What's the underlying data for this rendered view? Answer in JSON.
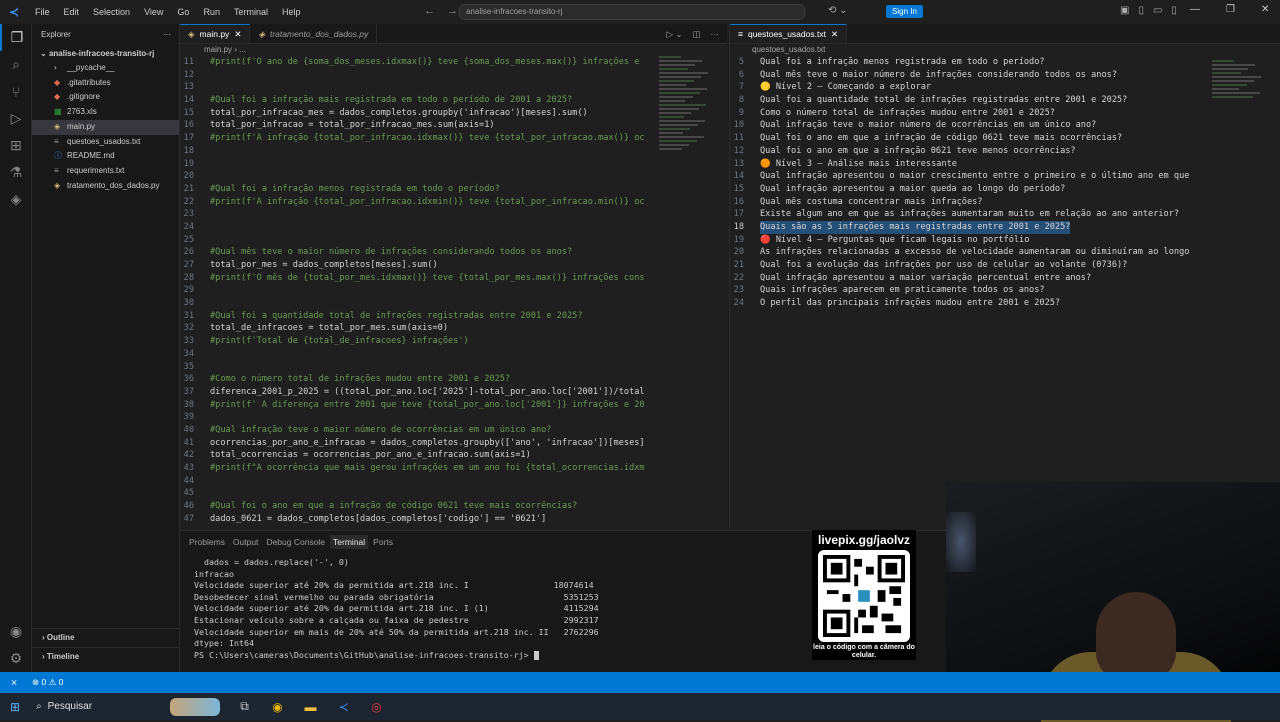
{
  "titlebar": {
    "menu": [
      "File",
      "Edit",
      "Selection",
      "View",
      "Go",
      "Run",
      "Terminal",
      "Help"
    ],
    "search": "analise-infracoes-transito-rj",
    "signin": "Sign In"
  },
  "explorer": {
    "header": "Explorer",
    "project": "analise-infracoes-transito-rj",
    "files": [
      {
        "name": "__pycache__",
        "icon": "chevron-right-icon",
        "glyph": "›"
      },
      {
        "name": ".gitattributes",
        "icon": "git-icon",
        "glyph": "◆"
      },
      {
        "name": ".gitignore",
        "icon": "git-icon",
        "glyph": "◆"
      },
      {
        "name": "2763.xls",
        "icon": "excel-icon",
        "glyph": "▦"
      },
      {
        "name": "main.py",
        "icon": "python-icon",
        "glyph": "◈"
      },
      {
        "name": "questoes_usados.txt",
        "icon": "text-file-icon",
        "glyph": "≡"
      },
      {
        "name": "README.md",
        "icon": "info-icon",
        "glyph": "ⓘ"
      },
      {
        "name": "requeriments.txt",
        "icon": "text-file-icon",
        "glyph": "≡"
      },
      {
        "name": "tratamento_dos_dados.py",
        "icon": "python-icon",
        "glyph": "◈"
      }
    ],
    "outline": "Outline",
    "timeline": "Timeline"
  },
  "editor_left": {
    "tabs": [
      "main.py",
      "tratamento_dos_dados.py"
    ],
    "breadcrumb": "main.py › ...",
    "lines": [
      {
        "n": "11",
        "t": "#print(f'O ano de {soma_dos_meses.idxmax()} teve {soma_dos_meses.max()} infrações e",
        "c": true
      },
      {
        "n": "12",
        "t": "",
        "c": false
      },
      {
        "n": "13",
        "t": "",
        "c": false
      },
      {
        "n": "14",
        "t": "#Qual foi a infração mais registrada em todo o período de 2001 a 2025?",
        "c": true
      },
      {
        "n": "15",
        "t": "total_por_infracao_mes = dados_completos.groupby('infracao')[meses].sum()",
        "c": false
      },
      {
        "n": "16",
        "t": "total_por_infracao = total_por_infracao_mes.sum(axis=1)",
        "c": false
      },
      {
        "n": "17",
        "t": "#print(f'A infração {total_por_infracao.idxmax()} teve {total_por_infracao.max()} oc",
        "c": true
      },
      {
        "n": "18",
        "t": "",
        "c": false
      },
      {
        "n": "19",
        "t": "",
        "c": false
      },
      {
        "n": "20",
        "t": "",
        "c": false
      },
      {
        "n": "21",
        "t": "#Qual foi a infração menos registrada em todo o período?",
        "c": true
      },
      {
        "n": "22",
        "t": "#print(f'A infração {total_por_infracao.idxmin()} teve {total_por_infracao.min()} oc",
        "c": true
      },
      {
        "n": "23",
        "t": "",
        "c": false
      },
      {
        "n": "24",
        "t": "",
        "c": false
      },
      {
        "n": "25",
        "t": "",
        "c": false
      },
      {
        "n": "26",
        "t": "#Qual mês teve o maior número de infrações considerando todos os anos?",
        "c": true
      },
      {
        "n": "27",
        "t": "total_por_mes = dados_completos[meses].sum()",
        "c": false
      },
      {
        "n": "28",
        "t": "#print(f'O mês de {total_por_mes.idxmax()} teve {total_por_mes.max()} infrações cons",
        "c": true
      },
      {
        "n": "29",
        "t": "",
        "c": false
      },
      {
        "n": "30",
        "t": "",
        "c": false
      },
      {
        "n": "31",
        "t": "#Qual foi a quantidade total de infrações registradas entre 2001 e 2025?",
        "c": true
      },
      {
        "n": "32",
        "t": "total_de_infracoes = total_por_mes.sum(axis=0)",
        "c": false
      },
      {
        "n": "33",
        "t": "#print(f'Total de {total_de_infracoes} infrações')",
        "c": true
      },
      {
        "n": "34",
        "t": "",
        "c": false
      },
      {
        "n": "35",
        "t": "",
        "c": false
      },
      {
        "n": "36",
        "t": "#Como o número total de infrações mudou entre 2001 e 2025?",
        "c": true
      },
      {
        "n": "37",
        "t": "diferenca_2001_p_2025 = ((total_por_ano.loc['2025']-total_por_ano.loc['2001'])/total",
        "c": false
      },
      {
        "n": "38",
        "t": "#print(f' A diferença entre 2001 que teve {total_por_ano.loc['2001']} infrações e 20",
        "c": true
      },
      {
        "n": "39",
        "t": "",
        "c": false
      },
      {
        "n": "40",
        "t": "#Qual infração teve o maior número de ocorrências em um único ano?",
        "c": true
      },
      {
        "n": "41",
        "t": "ocorrencias_por_ano_e_infracao = dados_completos.groupby(['ano', 'infracao'])[meses]",
        "c": false
      },
      {
        "n": "42",
        "t": "total_ocorrencias = ocorrencias_por_ano_e_infracao.sum(axis=1)",
        "c": false
      },
      {
        "n": "43",
        "t": "#print(f\"A ocorrência que mais gerou infrações em um ano foi {total_ocorrencias.idxm",
        "c": true
      },
      {
        "n": "44",
        "t": "",
        "c": false
      },
      {
        "n": "45",
        "t": "",
        "c": false
      },
      {
        "n": "46",
        "t": "#Qual foi o ano em que a infração de código 0621 teve mais ocorrências?",
        "c": true
      },
      {
        "n": "47",
        "t": "dados_0621 = dados_completos[dados_completos['codigo'] == '0621']",
        "c": false
      }
    ]
  },
  "editor_right": {
    "tab": "questoes_usados.txt",
    "breadcrumb": "questoes_usados.txt",
    "lines": [
      {
        "n": "5",
        "t": "Qual foi a infração menos registrada em todo o período?"
      },
      {
        "n": "6",
        "t": "Qual mês teve o maior número de infrações considerando todos os anos?"
      },
      {
        "n": "7",
        "t": "🟡 Nível 2 — Começando a explorar"
      },
      {
        "n": "8",
        "t": "Qual foi a quantidade total de infrações registradas entre 2001 e 2025?"
      },
      {
        "n": "9",
        "t": "Como o número total de infrações mudou entre 2001 e 2025?"
      },
      {
        "n": "10",
        "t": "Qual infração teve o maior número de ocorrências em um único ano?"
      },
      {
        "n": "11",
        "t": "Qual foi o ano em que a infração de código 0621 teve mais ocorrências?"
      },
      {
        "n": "12",
        "t": "Qual foi o ano em que a infração 0621 teve menos ocorrências?"
      },
      {
        "n": "13",
        "t": "🟠 Nível 3 — Análise mais interessante"
      },
      {
        "n": "14",
        "t": "Qual infração apresentou o maior crescimento entre o primeiro e o último ano em que"
      },
      {
        "n": "15",
        "t": "Qual infração apresentou a maior queda ao longo do período?"
      },
      {
        "n": "16",
        "t": "Qual mês costuma concentrar mais infrações?"
      },
      {
        "n": "17",
        "t": "Existe algum ano em que as infrações aumentaram muito em relação ao ano anterior?"
      },
      {
        "n": "18",
        "t": "Quais são as 5 infrações mais registradas entre 2001 e 2025?"
      },
      {
        "n": "19",
        "t": "🔴 Nível 4 — Perguntas que ficam legais no portfólio"
      },
      {
        "n": "20",
        "t": "As infrações relacionadas a excesso de velocidade aumentaram ou diminuíram ao longo"
      },
      {
        "n": "21",
        "t": "Qual foi a evolução das infrações por uso de celular ao volante (0736)?"
      },
      {
        "n": "22",
        "t": "Qual infração apresentou a maior variação percentual entre anos?"
      },
      {
        "n": "23",
        "t": "Quais infrações aparecem em praticamente todos os anos?"
      },
      {
        "n": "24",
        "t": "O perfil das principais infrações mudou entre 2001 e 2025?"
      }
    ]
  },
  "panel": {
    "tabs": [
      "Problems",
      "Output",
      "Debug Console",
      "Terminal",
      "Ports"
    ],
    "active_tab": "Terminal",
    "lines": [
      "  dados = dados.replace('-', 0)",
      "infracao",
      "Velocidade superior até 20% da permitida art.218 inc. I                 18074614",
      "Desobedecer sinal vermelho ou parada obrigatória                          5351253",
      "Velocidade superior até 20% da permitida art.218 inc. I (1)               4115294",
      "Estacionar veículo sobre a calçada ou faixa de pedestre                   2992317",
      "Velocidade superior em mais de 20% até 50% da permitida art.218 inc. II   2762296",
      "dtype: Int64"
    ],
    "prompt": "PS C:\\Users\\cameras\\Documents\\GitHub\\analise-infracoes-transito-rj> "
  },
  "overlay": {
    "url": "livepix.gg/jaolvz",
    "caption": "leia o código com a câmera do celular."
  },
  "statusbar": {
    "errors": "⊗ 0",
    "warnings": "⚠ 0"
  },
  "taskbar": {
    "search": "Pesquisar"
  },
  "colors": {
    "accent": "#0078d4",
    "comment": "#6a9955",
    "editor_bg": "#1f1f1f"
  }
}
